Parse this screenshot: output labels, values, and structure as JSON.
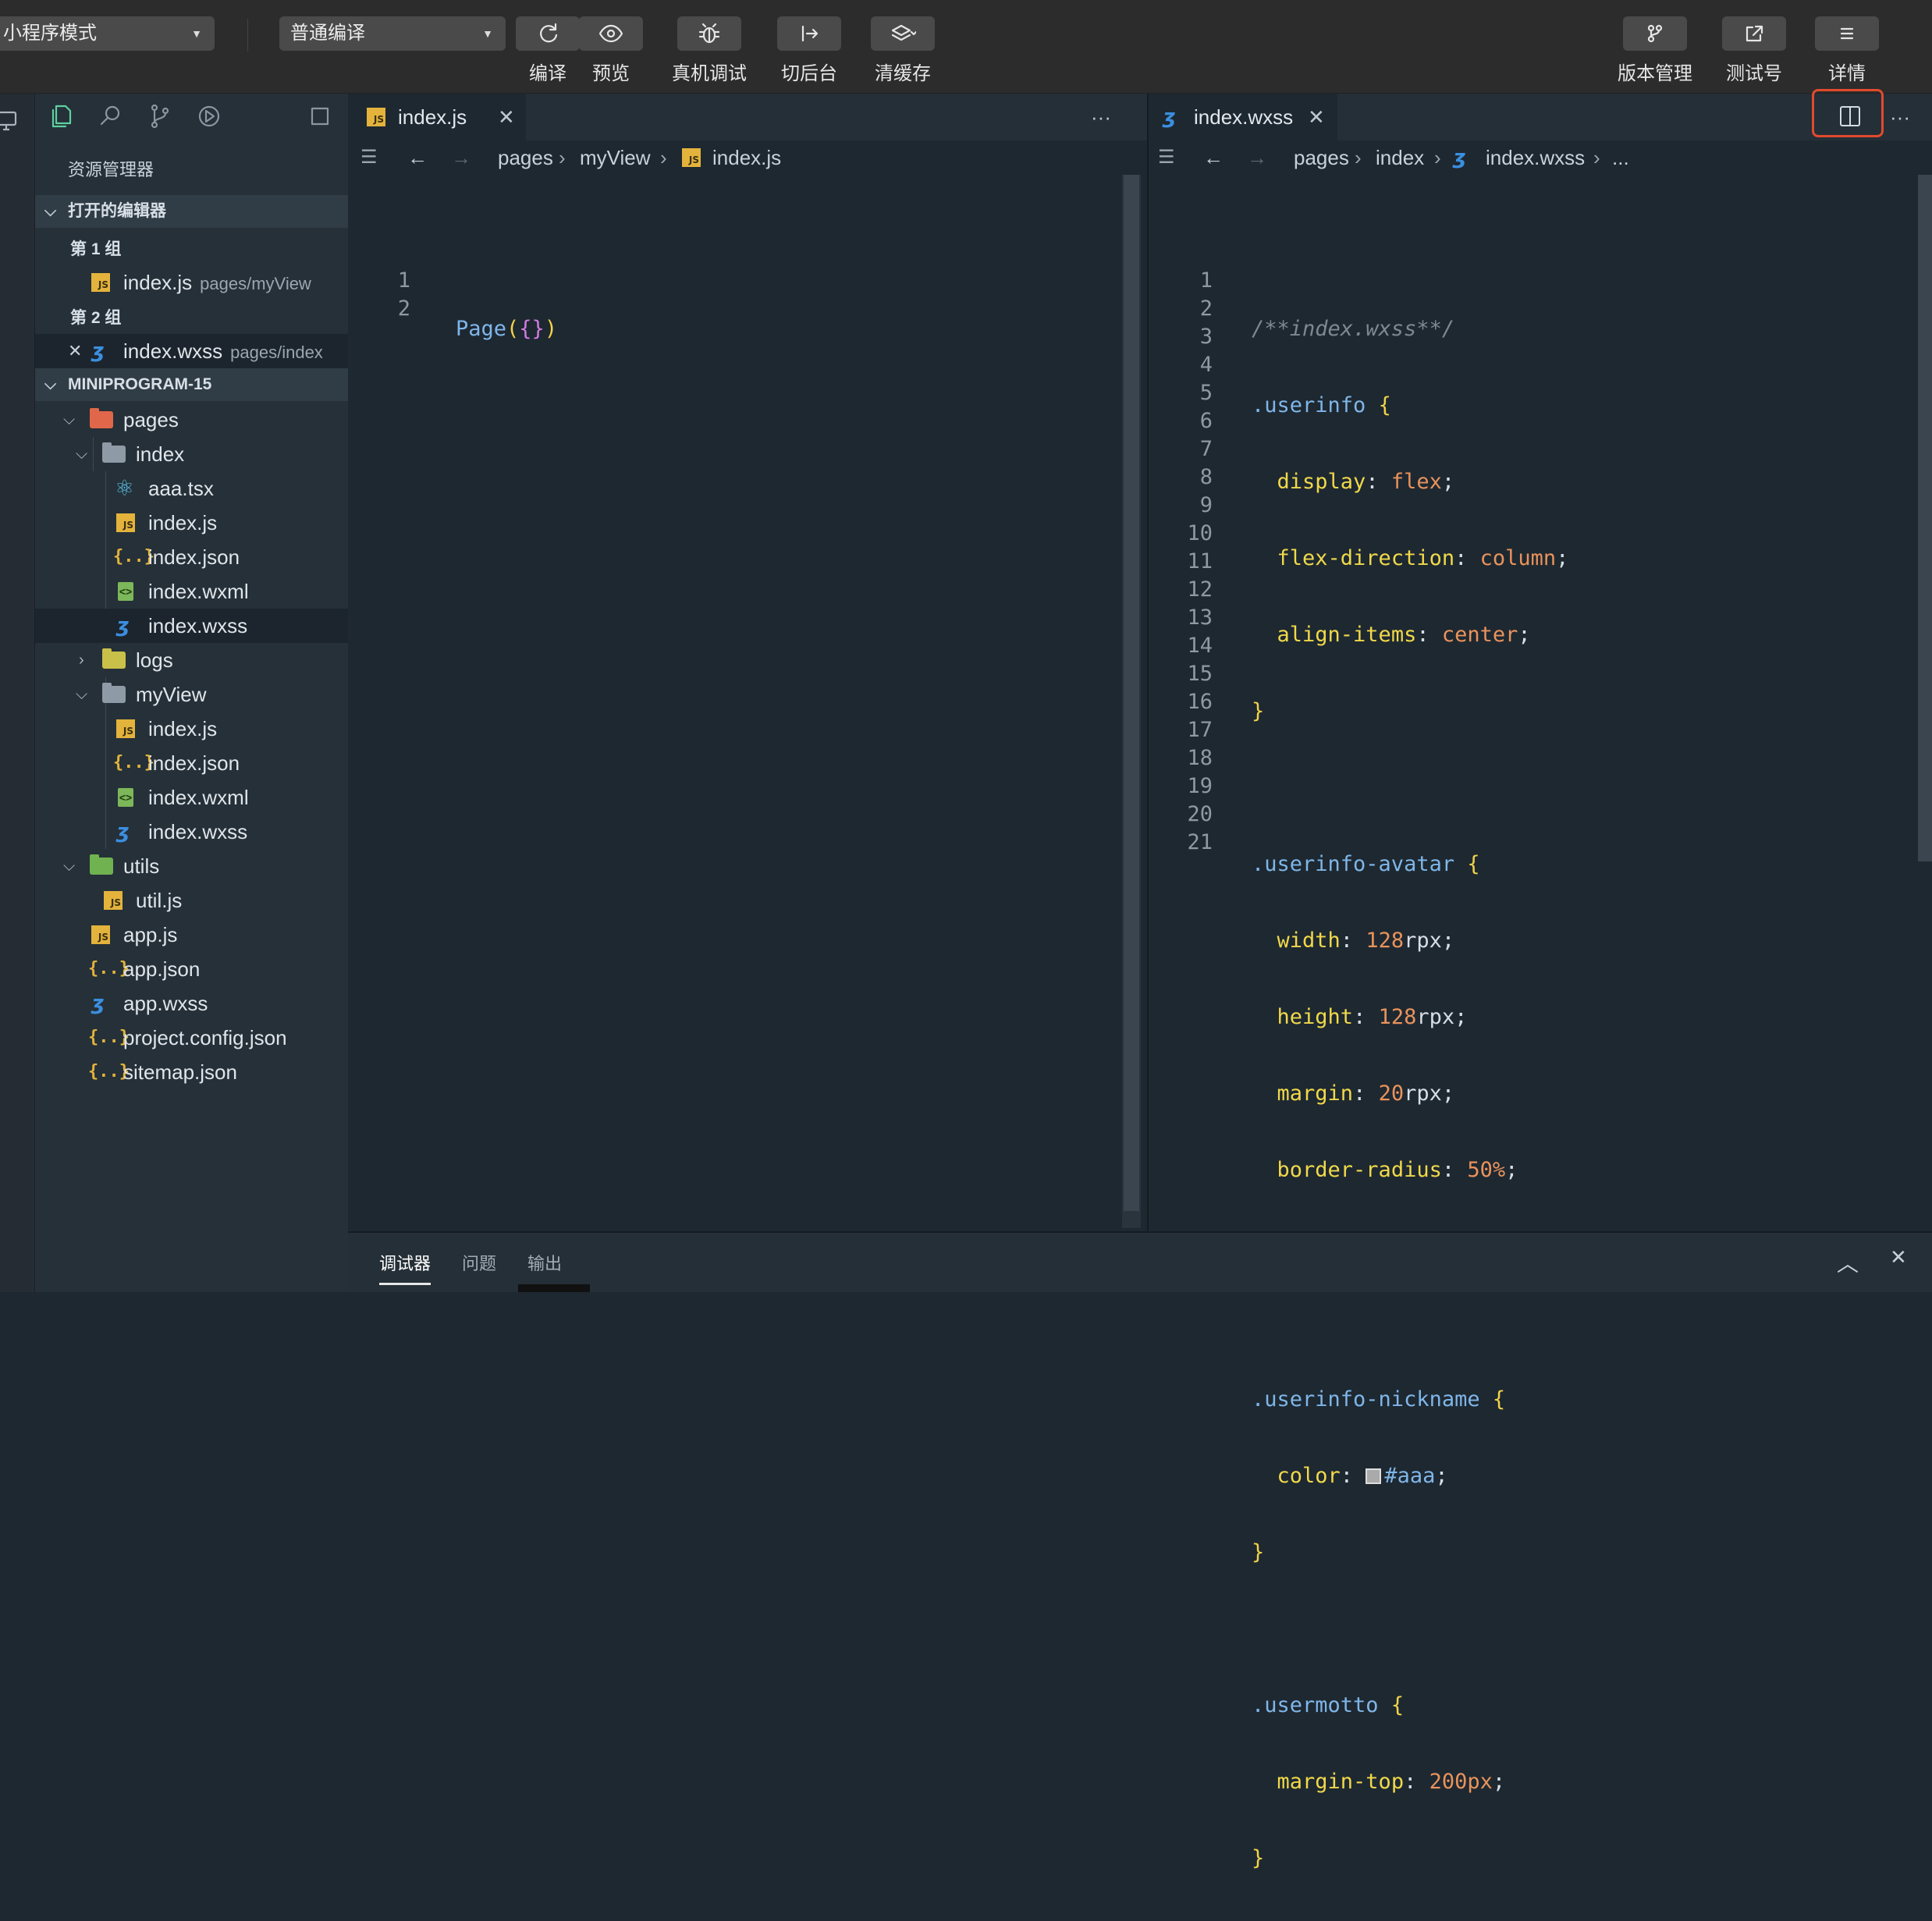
{
  "toolbar": {
    "mode_select": "小程序模式",
    "compile_select": "普通编译",
    "compile_label": "编译",
    "preview_label": "预览",
    "device_debug_label": "真机调试",
    "background_label": "切后台",
    "clear_cache_label": "清缓存",
    "version_label": "版本管理",
    "test_label": "测试号",
    "details_label": "详情"
  },
  "sidebar": {
    "title": "资源管理器",
    "open_editors": "打开的编辑器",
    "group1": "第 1 组",
    "group1_file": "index.js",
    "group1_path": "pages/myView",
    "group2": "第 2 组",
    "group2_file": "index.wxss",
    "group2_path": "pages/index",
    "project": "MINIPROGRAM-15",
    "tree": {
      "pages": "pages",
      "index": "index",
      "aaa": "aaa.tsx",
      "index_js": "index.js",
      "index_json": "index.json",
      "index_wxml": "index.wxml",
      "index_wxss": "index.wxss",
      "logs": "logs",
      "myView": "myView",
      "mv_js": "index.js",
      "mv_json": "index.json",
      "mv_wxml": "index.wxml",
      "mv_wxss": "index.wxss",
      "utils": "utils",
      "util_js": "util.js",
      "app_js": "app.js",
      "app_json": "app.json",
      "app_wxss": "app.wxss",
      "project_config": "project.config.json",
      "sitemap": "sitemap.json"
    }
  },
  "editor_left": {
    "tab": "index.js",
    "more": "···",
    "crumb": [
      "pages",
      "myView",
      "index.js"
    ],
    "lines": [
      "1",
      "2"
    ]
  },
  "editor_right": {
    "tab": "index.wxss",
    "more": "···",
    "crumb": [
      "pages",
      "index",
      "index.wxss",
      "..."
    ],
    "lines": [
      "1",
      "2",
      "3",
      "4",
      "5",
      "6",
      "7",
      "8",
      "9",
      "10",
      "11",
      "12",
      "13",
      "14",
      "15",
      "16",
      "17",
      "18",
      "19",
      "20",
      "21"
    ]
  },
  "panel": {
    "tabs": [
      "调试器",
      "问题",
      "输出"
    ]
  },
  "colors": {
    "highlight": "#e24a2d",
    "js_icon": "#e3b33c",
    "css_icon": "#3b8fe0"
  }
}
